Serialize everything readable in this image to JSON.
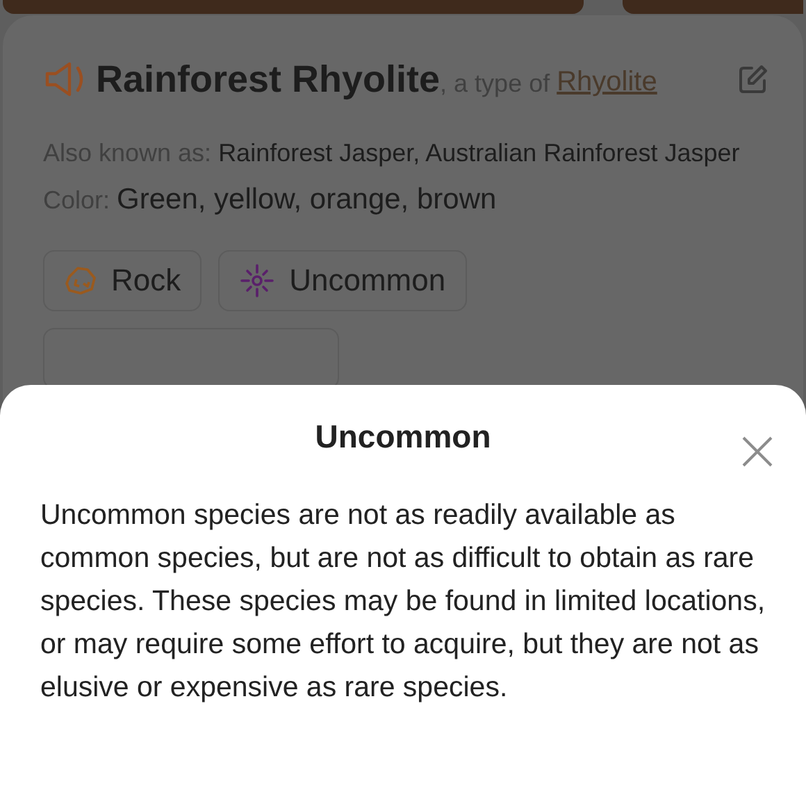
{
  "card": {
    "name": "Rainforest Rhyolite",
    "type_prefix": ", a type of ",
    "type_link": "Rhyolite",
    "aka_label": "Also known as: ",
    "aka_value": "Rainforest Jasper, Australian Rainforest Jasper",
    "color_label": "Color: ",
    "color_value": "Green, yellow, orange, brown",
    "chips": [
      {
        "kind": "rock",
        "label": "Rock"
      },
      {
        "kind": "rarity",
        "label": "Uncommon"
      }
    ]
  },
  "sheet": {
    "title": "Uncommon",
    "body": "Uncommon species are not as readily available as common species, but are not as difficult to obtain as rare species. These species may be found in limited locations, or may require some effort to acquire, but they are not as elusive or expensive as rare species."
  }
}
